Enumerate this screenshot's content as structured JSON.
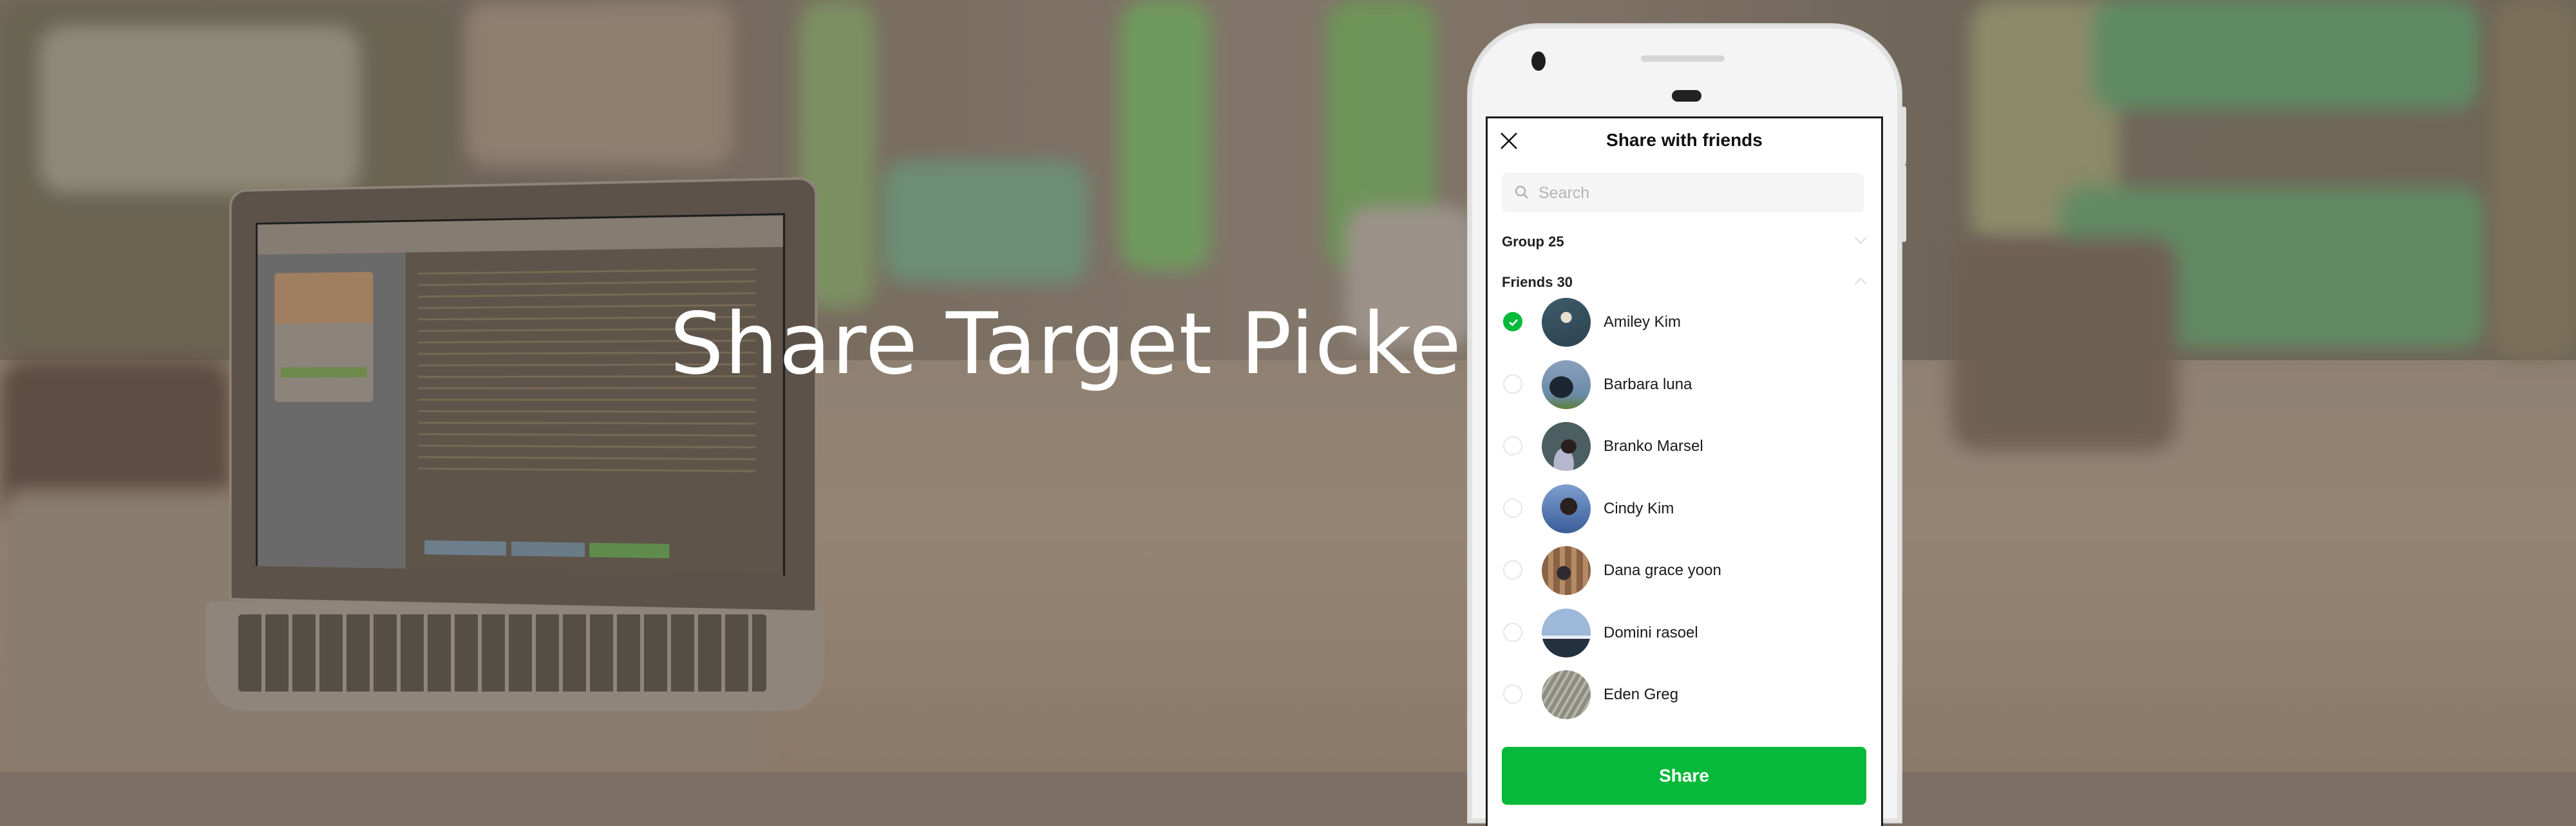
{
  "banner": {
    "title": "Share Target Picker"
  },
  "share_dialog": {
    "header_title": "Share with friends",
    "close_icon": "close-icon",
    "search": {
      "placeholder": "Search",
      "value": "",
      "icon": "search-icon"
    },
    "sections": [
      {
        "label": "Group 25",
        "expanded": false,
        "icon": "chevron-down-icon"
      },
      {
        "label": "Friends 30",
        "expanded": true,
        "icon": "chevron-up-icon"
      }
    ],
    "friends": [
      {
        "name": "Amiley Kim",
        "selected": true
      },
      {
        "name": "Barbara luna",
        "selected": false
      },
      {
        "name": "Branko Marsel",
        "selected": false
      },
      {
        "name": "Cindy Kim",
        "selected": false
      },
      {
        "name": "Dana grace yoon",
        "selected": false
      },
      {
        "name": "Domini rasoel",
        "selected": false
      },
      {
        "name": "Eden Greg",
        "selected": false
      }
    ],
    "share_button_label": "Share"
  },
  "colors": {
    "accent_green": "#06b93a",
    "overlay_brown": "#7d6f63"
  }
}
